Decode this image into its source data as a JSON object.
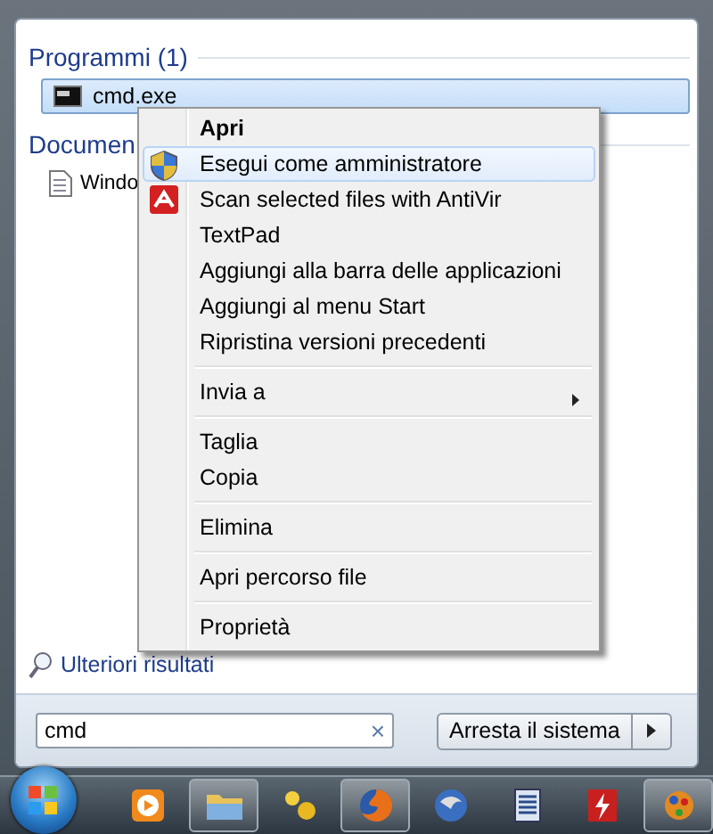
{
  "results": [
    {
      "heading": "Programmi (1)",
      "items": [
        {
          "label": "cmd.exe",
          "selected": true
        }
      ]
    },
    {
      "heading": "Documen",
      "items": [
        {
          "label": "Windo",
          "selected": false
        }
      ]
    }
  ],
  "context_menu": [
    {
      "kind": "item",
      "label": "Apri",
      "default": true,
      "submenu": false,
      "selected": false
    },
    {
      "kind": "item",
      "label": "Esegui come amministratore",
      "default": false,
      "submenu": false,
      "selected": true
    },
    {
      "kind": "item",
      "label": "Scan selected files with AntiVir",
      "default": false,
      "submenu": false,
      "selected": false
    },
    {
      "kind": "item",
      "label": "TextPad",
      "default": false,
      "submenu": false,
      "selected": false
    },
    {
      "kind": "item",
      "label": "Aggiungi alla barra delle applicazioni",
      "default": false,
      "submenu": false,
      "selected": false
    },
    {
      "kind": "item",
      "label": "Aggiungi al menu Start",
      "default": false,
      "submenu": false,
      "selected": false
    },
    {
      "kind": "item",
      "label": "Ripristina versioni precedenti",
      "default": false,
      "submenu": false,
      "selected": false
    },
    {
      "kind": "separator"
    },
    {
      "kind": "item",
      "label": "Invia a",
      "submenu": true,
      "default": false,
      "selected": false
    },
    {
      "kind": "separator"
    },
    {
      "kind": "item",
      "label": "Taglia",
      "default": false,
      "submenu": false,
      "selected": false
    },
    {
      "kind": "item",
      "label": "Copia",
      "default": false,
      "submenu": false,
      "selected": false
    },
    {
      "kind": "separator"
    },
    {
      "kind": "item",
      "label": "Elimina",
      "default": false,
      "submenu": false,
      "selected": false
    },
    {
      "kind": "separator"
    },
    {
      "kind": "item",
      "label": "Apri percorso file",
      "default": false,
      "submenu": false,
      "selected": false
    },
    {
      "kind": "separator"
    },
    {
      "kind": "item",
      "label": "Proprietà",
      "default": false,
      "submenu": false,
      "selected": false
    }
  ],
  "more_results": "Ulteriori risultati",
  "search": {
    "value": "cmd",
    "clear": "×"
  },
  "shutdown_button": "Arresta il sistema",
  "taskbar": [
    {
      "running": false
    },
    {
      "running": true
    },
    {
      "running": false
    },
    {
      "running": true
    },
    {
      "running": false
    },
    {
      "running": false
    },
    {
      "running": false
    },
    {
      "running": true
    }
  ]
}
